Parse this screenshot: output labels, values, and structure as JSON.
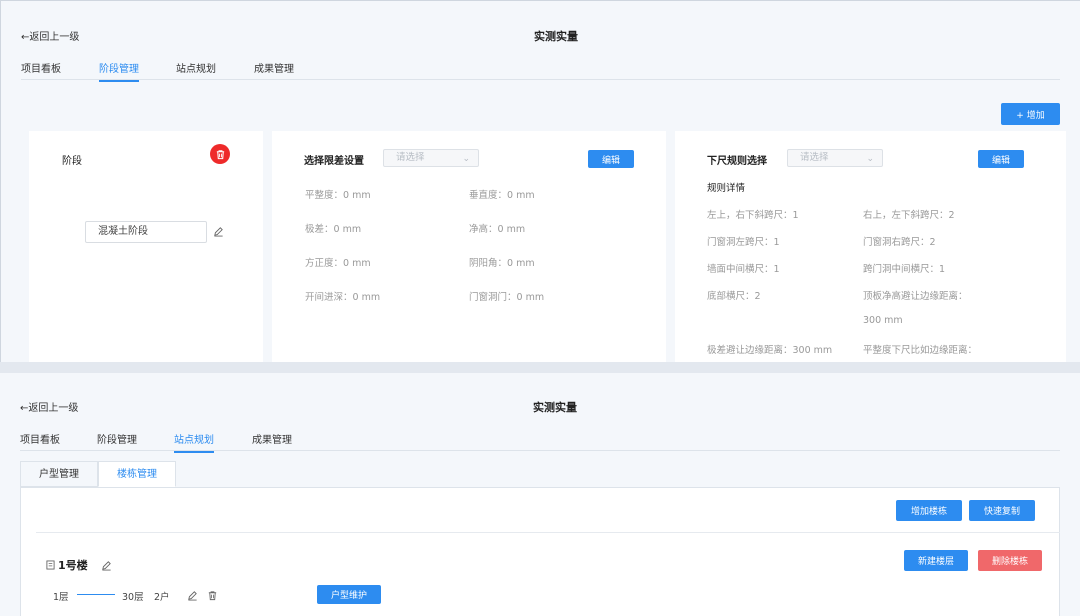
{
  "top": {
    "back_label": "←返回上一级",
    "title": "实测实量",
    "tabs": [
      "项目看板",
      "阶段管理",
      "站点规划",
      "成果管理"
    ],
    "active_tab": 1,
    "add_button": "+ 增加",
    "stage_card": {
      "title": "阶段",
      "stage_name": "混凝土阶段"
    },
    "tolerance_card": {
      "title": "选择限差设置",
      "select_placeholder": "请选择",
      "edit_button": "编辑",
      "fields": [
        "平整度：0 mm",
        "垂直度：0 mm",
        "极差：0 mm",
        "净高：0 mm",
        "方正度：0 mm",
        "阴阳角：0 mm",
        "开间进深：0 mm",
        "门窗洞门：0 mm"
      ]
    },
    "rule_card": {
      "title": "下尺规则选择",
      "select_placeholder": "请选择",
      "edit_button": "编辑",
      "details_title": "规则详情",
      "fields": [
        "左上，右下斜跨尺：1",
        "右上，左下斜跨尺：2",
        "门窗洞左跨尺：1",
        "门窗洞右跨尺：2",
        "墙面中间横尺：1",
        "跨门洞中间横尺：1",
        "底部横尺：2",
        "顶板净高避让边缘距离：",
        "300 mm",
        "极差避让边缘距离：300 mm",
        "平整度下尺比如边缘距离："
      ]
    }
  },
  "bottom": {
    "back_label": "←返回上一级",
    "title": "实测实量",
    "tabs": [
      "项目看板",
      "阶段管理",
      "站点规划",
      "成果管理"
    ],
    "active_tab": 2,
    "subtabs": [
      "户型管理",
      "楼栋管理"
    ],
    "active_subtab": 1,
    "add_building_button": "增加楼栋",
    "quick_copy_button": "快速复制",
    "building": {
      "name": "1号楼",
      "new_floor_button": "新建楼层",
      "delete_building_button": "删除楼栋",
      "floor_from": "1层",
      "floor_to": "30层",
      "units": "2户",
      "unit_maintain_button": "户型维护"
    }
  },
  "colors": {
    "accent": "#2d8cf0",
    "danger": "#f0686a",
    "trash_badge": "#ee2a2a"
  }
}
